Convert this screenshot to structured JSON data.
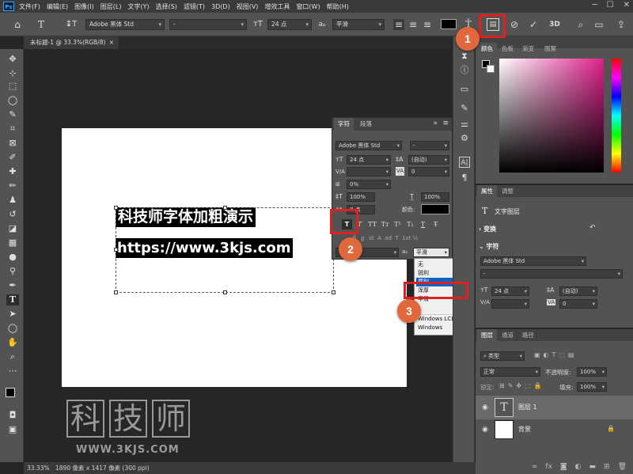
{
  "menubar": {
    "logo": "Ps",
    "items": [
      "文件(F)",
      "编辑(E)",
      "图像(I)",
      "图层(L)",
      "文字(Y)",
      "选择(S)",
      "滤镜(T)",
      "3D(D)",
      "视图(V)",
      "增效工具",
      "窗口(W)",
      "帮助(H)"
    ]
  },
  "optionsbar": {
    "font_family": "Adobe 黑体 Std",
    "font_style": "-",
    "font_size": "24 点",
    "antialias": "平滑",
    "color": "#000000"
  },
  "document": {
    "tab_label": "未标题-1 @ 33.3%(RGB/8)",
    "tab_close": "×",
    "text_line1": "科技师字体加粗演示",
    "text_line2": "https://www.3kjs.com"
  },
  "watermark": {
    "chars": [
      "科",
      "技",
      "师"
    ],
    "url": "WWW.3KJS.COM"
  },
  "statusbar": {
    "zoom": "33.33%",
    "info": "1890 像素 x 1417 像素 (300 ppi)"
  },
  "char_panel": {
    "tabs": [
      "字符",
      "段落"
    ],
    "font_family": "Adobe 黑体 Std",
    "font_style": "-",
    "font_size": "24 点",
    "leading": "(自动)",
    "tracking": "0",
    "scale_percent": "0%",
    "vert_scale": "100%",
    "horiz_scale": "100%",
    "baseline": "0 点",
    "color_label": "颜色:",
    "faux_bold": "T",
    "style_buttons": [
      "T",
      "TT",
      "Tт",
      "T¹",
      "T₁",
      "T",
      "T̶"
    ],
    "lang_label": "aₐ",
    "antialias": "平滑"
  },
  "aa_dropdown": {
    "options": [
      "无",
      "锐利",
      "犀利",
      "浑厚",
      "平滑",
      "Windows LCD",
      "Windows"
    ]
  },
  "color_panel": {
    "tabs": [
      "颜色",
      "色板",
      "渐变",
      "图案"
    ],
    "hue_color": "#e0208c"
  },
  "properties_panel": {
    "tabs": [
      "属性",
      "调整"
    ],
    "layer_type": "文字图层",
    "transform_label": "变换",
    "char_label": "字符",
    "font_family": "Adobe 黑体 Std",
    "font_style": "-",
    "font_size": "24 点",
    "leading": "(自动)",
    "tracking": "0"
  },
  "layers_panel": {
    "tabs": [
      "图层",
      "通道",
      "路径"
    ],
    "filter_label": "类型",
    "blend_mode": "正常",
    "opacity_label": "不透明度:",
    "opacity": "100%",
    "lock_label": "锁定:",
    "fill_label": "填充:",
    "fill": "100%",
    "layers": [
      {
        "name": "图层 1",
        "type": "text",
        "selected": true
      },
      {
        "name": "背景",
        "type": "background",
        "selected": false
      }
    ]
  },
  "callouts": [
    "1",
    "2",
    "3"
  ],
  "colors": {
    "callout_red": "#e02020",
    "badge_orange": "#e0683c"
  }
}
